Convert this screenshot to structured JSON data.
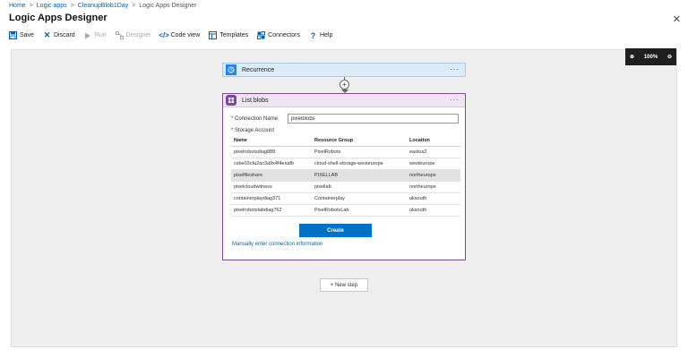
{
  "breadcrumb": [
    "Home",
    "Logic apps",
    "CleanupBlob1Day",
    "Logic Apps Designer"
  ],
  "title": "Logic Apps Designer",
  "toolbar": {
    "save": "Save",
    "discard": "Discard",
    "run": "Run",
    "designer": "Designer",
    "code_view": "Code view",
    "templates": "Templates",
    "connectors": "Connectors",
    "help": "Help"
  },
  "zoom": {
    "level": "100%"
  },
  "recurrence": {
    "label": "Recurrence"
  },
  "list_blobs": {
    "label": "List blobs",
    "connection_name_label": "Connection Name",
    "connection_name_value": "pixelblobs",
    "storage_account_label": "Storage Account",
    "columns": [
      "Name",
      "Resource Group",
      "Location"
    ],
    "rows": [
      [
        "pixelrobotsdiag888",
        "PixelRobots",
        "eastus2"
      ],
      [
        "csbe03cfa2ac3a9x4f4exafb",
        "cloud-shell-storage-westeurope",
        "westeurope"
      ],
      [
        "pixelfileshare",
        "PIXELLAB",
        "northeurope"
      ],
      [
        "pixelcloudwitness",
        "pixellab",
        "northeurope"
      ],
      [
        "containerplaydiag371",
        "Containerplay",
        "uksouth"
      ],
      [
        "pixelrobotslabdiag762",
        "PixelRobotsLab",
        "uksouth"
      ]
    ],
    "selected_row": 2,
    "create_button": "Create",
    "manual_link": "Manually enter connection information"
  },
  "new_step": "+ New step",
  "colors": {
    "accent": "#0072c6",
    "recurrence": "#1f85ff",
    "blob": "#7a4aa0"
  }
}
